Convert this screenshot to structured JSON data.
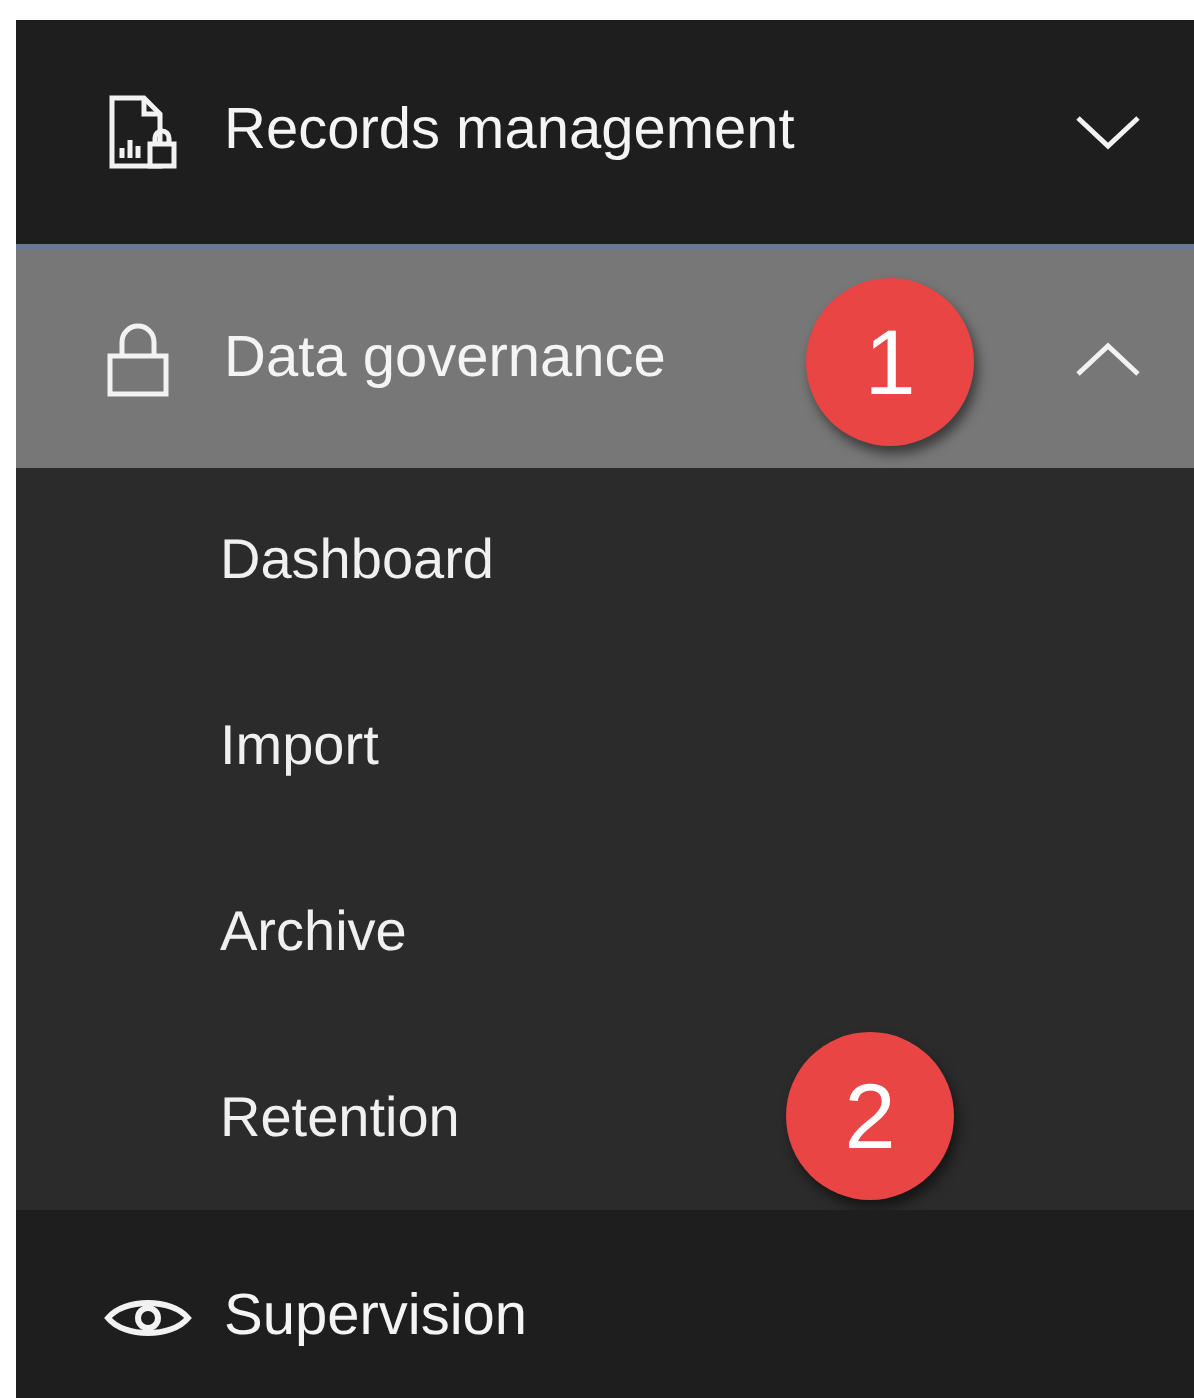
{
  "nav": [
    {
      "kind": "group",
      "label": "Records management",
      "expanded": false,
      "selected": false
    },
    {
      "kind": "group",
      "label": "Data governance",
      "expanded": true,
      "selected": true,
      "badge": "1",
      "children": [
        {
          "label": "Dashboard",
          "selected": false
        },
        {
          "label": "Import",
          "selected": false
        },
        {
          "label": "Archive",
          "selected": false
        },
        {
          "label": "Retention",
          "selected": false,
          "badge": "2"
        }
      ]
    },
    {
      "kind": "link",
      "label": "Supervision",
      "selected": false
    }
  ]
}
